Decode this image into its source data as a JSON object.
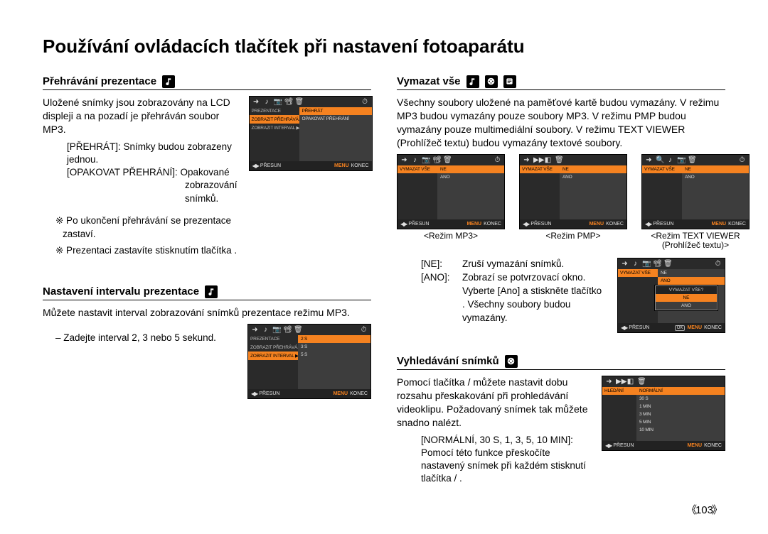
{
  "page_title": "Používání ovládacích tlačítek při nastavení fotoaparátu",
  "page_number": "103",
  "left": {
    "sec1": {
      "title": "Přehrávání prezentace",
      "icon": "music-note-icon",
      "intro": "Uložené snímky jsou zobrazovány na LCD displeji a na pozadí je přehráván soubor MP3.",
      "opts": [
        "[PŘEHRÁT]: Snímky budou zobrazeny jednou.",
        "[OPAKOVAT PŘEHRÁNÍ]: Opakované",
        "zobrazování",
        "snímků."
      ],
      "bullets": [
        "※  Po ukončení přehrávání se prezentace zastaví.",
        "※  Prezentaci zastavíte stisknutím tlačítka ."
      ],
      "lcd": {
        "tabs": [
          "PREZENTACE",
          "ZOBRAZIT PŘEHRÁVÁ.▶",
          "ZOBRAZIT INTERVAL ▶"
        ],
        "highlight_tab": 1,
        "list": [
          "PŘEHRÁT",
          "OPAKOVAT PŘEHRÁNÍ"
        ],
        "highlight_li": 0,
        "footer_move": "PŘESUN",
        "footer_menu": "MENU",
        "footer_exit": "KONEC"
      }
    },
    "sec2": {
      "title": "Nastavení intervalu prezentace",
      "icon": "music-note-icon",
      "intro": "Můžete nastavit interval zobrazování snímků prezentace režimu MP3.",
      "bullet": "–   Zadejte interval 2, 3 nebo 5 sekund.",
      "lcd": {
        "tabs": [
          "PREZENTACE",
          "ZOBRAZIT PŘEHRÁVÁ.▶",
          "ZOBRAZIT INTERVAL ▶"
        ],
        "highlight_tab": 2,
        "list": [
          "2 S",
          "3 S",
          "5 S"
        ],
        "highlight_li": 0,
        "footer_move": "PŘESUN",
        "footer_menu": "MENU",
        "footer_exit": "KONEC"
      }
    }
  },
  "right": {
    "sec1": {
      "title": "Vymazat vše",
      "intro": "Všechny soubory uložené na paměťové kartě budou vymazány. V režimu MP3 budou vymazány pouze soubory MP3. V režimu PMP budou vymazány pouze multimediální soubory. V režimu TEXT VIEWER (Prohlížeč textu) budou vymazány textové soubory.",
      "modes": [
        {
          "label": "<Režim MP3>",
          "topicons": [
            "➜",
            "♪",
            "📷",
            "📽",
            "🗑",
            "⏱"
          ]
        },
        {
          "label": "<Režim PMP>",
          "topicons": [
            "➜",
            "▶▶",
            "◧",
            "🗑"
          ]
        },
        {
          "label": "<Režim TEXT VIEWER (Prohlížeč textu)>",
          "topicons": [
            "➜",
            "🔍",
            "♪",
            "📷",
            "🗑",
            "⏱"
          ]
        }
      ],
      "lcd_common": {
        "tabs": [
          "VYMAZAT VŠE"
        ],
        "highlight_tab": 0,
        "list": [
          "NE",
          "ANO"
        ],
        "highlight_li": 0,
        "footer_move": "PŘESUN",
        "footer_menu": "MENU",
        "footer_exit": "KONEC"
      },
      "kv": [
        {
          "k": "[NE]:",
          "v": "Zruší vymazání snímků."
        },
        {
          "k": "[ANO]:",
          "v": "Zobrazí se potvrzovací okno. Vyberte [Ano] a stiskněte tlačítko . Všechny soubory budou vymazány."
        }
      ],
      "confirm_lcd": {
        "tabs": [
          "VYMAZAT VŠE"
        ],
        "list": [
          "NE",
          "ANO"
        ],
        "dialog_title": "VYMAZAT VŠE?",
        "dialog_opts": [
          "NE",
          "ANO"
        ],
        "dialog_hl": 0,
        "footer_move": "PŘESUN",
        "footer_menu": "MENU",
        "footer_exit": "KONEC"
      }
    },
    "sec2": {
      "title": "Vyhledávání snímků",
      "icon": "film-icon",
      "intro": "Pomocí tlačítka / můžete nastavit dobu rozsahu přeskakování při prohledávání videoklipu. Požadovaný snímek tak můžete snadno nalézt.",
      "desc": "[NORMÁLNÍ, 30 S, 1, 3, 5, 10 MIN]: Pomocí této funkce přeskočíte nastavený snímek při každém stisknutí tlačítka / .",
      "lcd": {
        "tabs": [
          "HLEDÁNÍ"
        ],
        "list": [
          "NORMÁLNÍ",
          "30 S",
          "1 MIN",
          "3 MIN",
          "5 MIN",
          "10 MIN"
        ],
        "highlight_li": 0,
        "footer_move": "PŘESUN",
        "footer_menu": "MENU",
        "footer_exit": "KONEC"
      }
    }
  }
}
